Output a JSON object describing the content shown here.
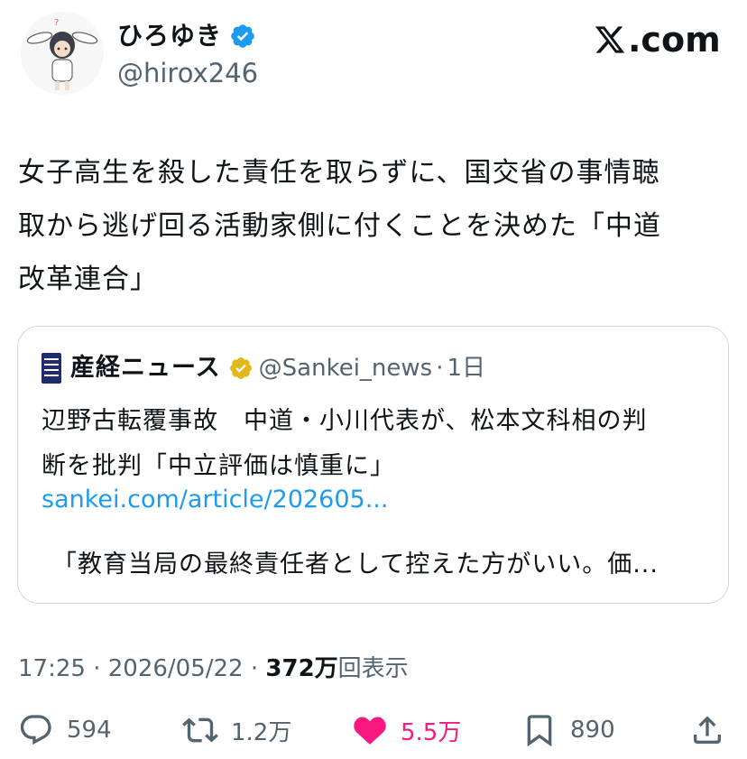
{
  "author": {
    "display_name": "ひろゆき",
    "handle": "@hirox246",
    "verified_color": "#1d9bf0"
  },
  "brand": {
    "site": ".com",
    "logo_icon": "x-logo-icon"
  },
  "tweet": {
    "text": "女子高生を殺した責任を取らずに、国交省の事情聴\n取から逃げ回る活動家側に付くことを決めた「中道\n改革連合」"
  },
  "quote": {
    "display_name": "産経ニュース",
    "handle": "@Sankei_news",
    "separator": "·",
    "time": "1日",
    "badge_color": "#e2b719",
    "text": "辺野古転覆事故　中道・小川代表が、松本文科相の判\n断を批判「中立評価は慎重に」",
    "link": "sankei.com/article/202605...",
    "body_preview": "「教育当局の最終責任者として控えた方がいい。価..."
  },
  "meta": {
    "time": "17:25",
    "sep1": " · ",
    "date": "2026/05/22",
    "sep2": " · ",
    "views": "372万",
    "views_label": "回表示"
  },
  "actions": {
    "replies": "594",
    "retweets": "1.2万",
    "likes": "5.5万",
    "bookmarks": "890",
    "like_color": "#f91880"
  }
}
